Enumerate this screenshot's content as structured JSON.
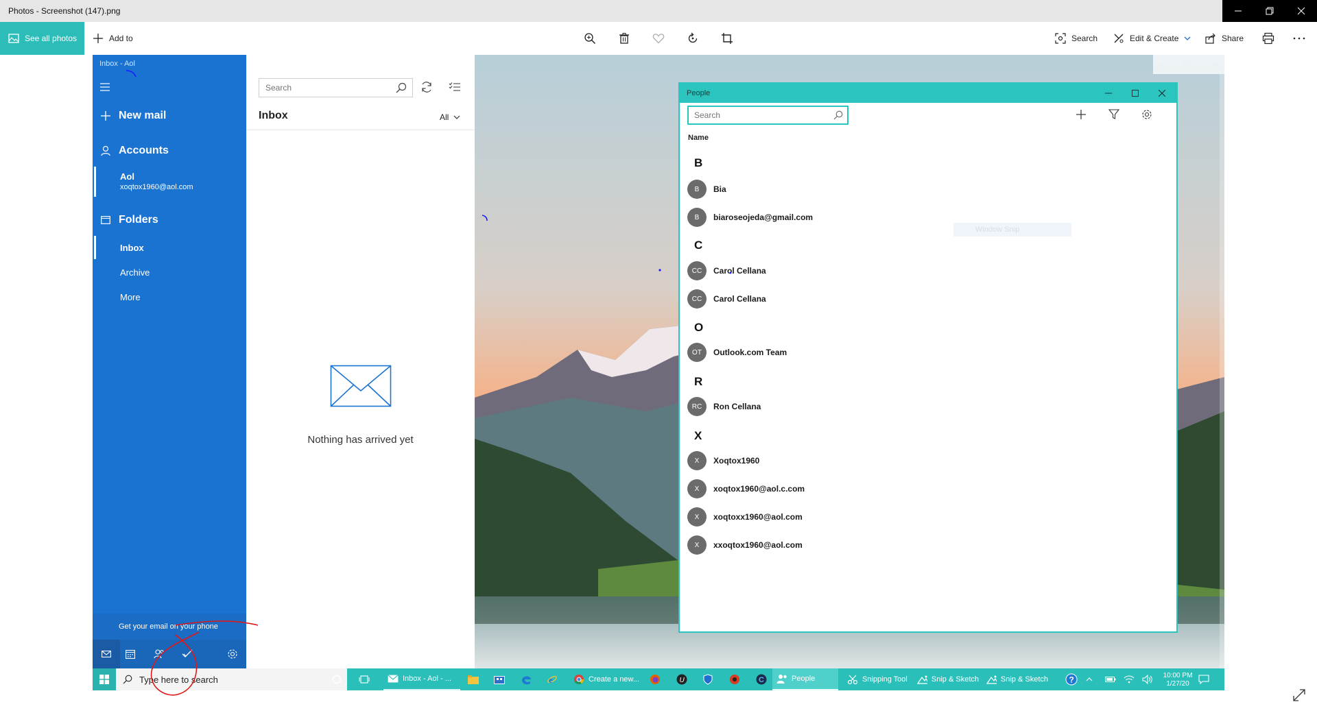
{
  "photos": {
    "window_title": "Photos - Screenshot (147).png",
    "see_all_photos": "See all photos",
    "add_to": "Add to",
    "search": "Search",
    "edit_create": "Edit & Create",
    "share": "Share"
  },
  "mail": {
    "sidebar": {
      "title": "Inbox - Aol",
      "new_mail": "New mail",
      "accounts": "Accounts",
      "account_name": "Aol",
      "account_email": "xoqtox1960@aol.com",
      "folders": "Folders",
      "folder_items": [
        "Inbox",
        "Archive",
        "More"
      ],
      "promo": "Get your email on your phone"
    },
    "list": {
      "search_placeholder": "Search",
      "heading": "Inbox",
      "filter": "All",
      "empty_message": "Nothing has arrived yet"
    }
  },
  "people": {
    "title": "People",
    "search_placeholder": "Search",
    "column_header": "Name",
    "groups": [
      {
        "letter": "B",
        "contacts": [
          {
            "initials": "B",
            "name": "Bia"
          },
          {
            "initials": "B",
            "name": "biaroseojeda@gmail.com"
          }
        ]
      },
      {
        "letter": "C",
        "contacts": [
          {
            "initials": "CC",
            "name": "Carol Cellana"
          },
          {
            "initials": "CC",
            "name": "Carol Cellana"
          }
        ]
      },
      {
        "letter": "O",
        "contacts": [
          {
            "initials": "OT",
            "name": "Outlook.com Team"
          }
        ]
      },
      {
        "letter": "R",
        "contacts": [
          {
            "initials": "RC",
            "name": "Ron Cellana"
          }
        ]
      },
      {
        "letter": "X",
        "contacts": [
          {
            "initials": "X",
            "name": "Xoqtox1960"
          },
          {
            "initials": "X",
            "name": "xoqtox1960@aol.c.com"
          },
          {
            "initials": "X",
            "name": "xoqtoxx1960@aol.com"
          },
          {
            "initials": "X",
            "name": "xxoqtox1960@aol.com"
          }
        ]
      }
    ]
  },
  "window_snip_hint": "Window Snip",
  "taskbar": {
    "search_placeholder": "Type here to search",
    "mail_task": "Inbox - Aol - ...",
    "chrome_task": "Create a new...",
    "people_task": "People",
    "snipping_task": "Snipping Tool",
    "snip_sketch_1": "Snip & Sketch",
    "snip_sketch_2": "Snip & Sketch",
    "time": "10:00 PM",
    "date": "1/27/20"
  },
  "colors": {
    "teal": "#2cc4be",
    "mail_blue": "#1a73d1",
    "annotation_red": "#e01818"
  }
}
